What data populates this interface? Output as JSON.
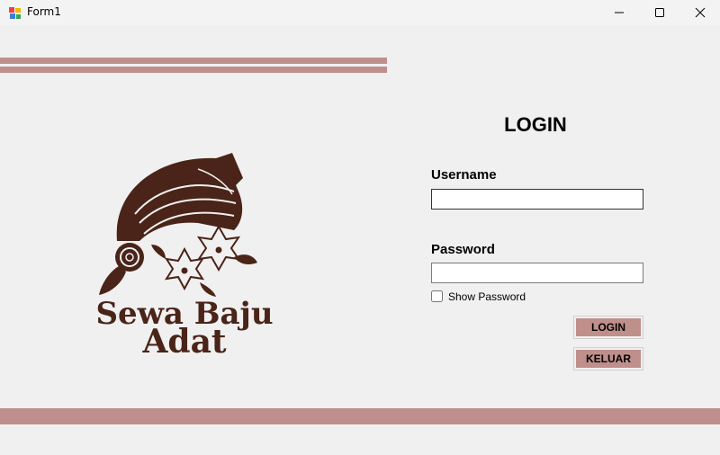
{
  "window": {
    "title": "Form1",
    "app_icon": "winforms-app-icon",
    "controls": [
      "minimize-icon",
      "maximize-icon",
      "close-icon"
    ]
  },
  "logo": {
    "line1": "Sewa Baju",
    "line2": "Adat",
    "icon": "headwrap-with-flowers-logo"
  },
  "login": {
    "title": "LOGIN",
    "username_label": "Username",
    "username_value": "",
    "password_label": "Password",
    "password_value": "",
    "show_password_label": "Show Password",
    "show_password_checked": false,
    "login_button": "LOGIN",
    "exit_button": "KELUAR"
  },
  "colors": {
    "accent": "#bf8f8c",
    "logo_brown": "#4a2418",
    "background": "#f0f0f0"
  }
}
